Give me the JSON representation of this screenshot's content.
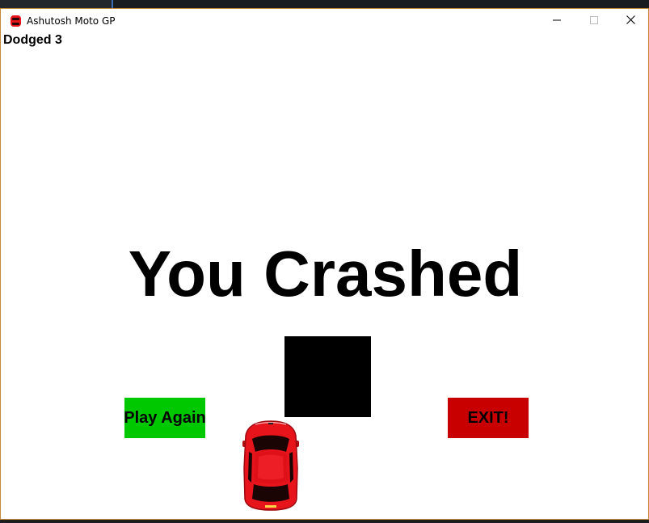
{
  "window": {
    "title": "Ashutosh Moto GP",
    "controls": {
      "minimize": "minimize",
      "maximize": "maximize",
      "close": "close"
    }
  },
  "game": {
    "score_text": "Dodged 3",
    "crash_message": "You Crashed",
    "buttons": {
      "play_again": "Play Again",
      "exit": "EXIT!"
    },
    "colors": {
      "play_again": "#00c800",
      "exit": "#c80000",
      "obstacle": "#000000",
      "car": "#e8141c",
      "background": "#ffffff"
    },
    "icons": {
      "app": "red-car-icon",
      "player": "red-car-sprite",
      "obstacle": "black-block"
    }
  }
}
